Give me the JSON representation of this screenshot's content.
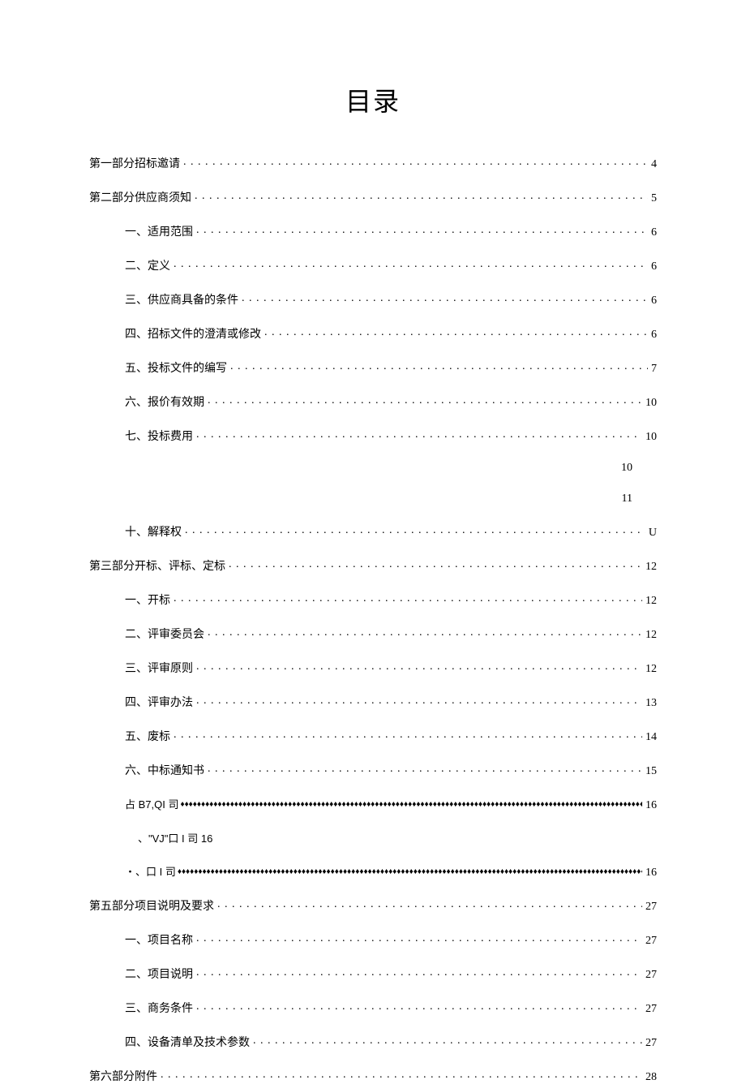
{
  "title": "目录",
  "entries": [
    {
      "level": 1,
      "label": "第一部分招标邀请",
      "page": "4",
      "leader": "dot"
    },
    {
      "level": 1,
      "label": "第二部分供应商须知",
      "page": "5",
      "leader": "dot"
    },
    {
      "level": 2,
      "label": "一、适用范围",
      "page": "6",
      "leader": "dot"
    },
    {
      "level": 2,
      "label": "二、定义",
      "page": "6",
      "leader": "dot"
    },
    {
      "level": 2,
      "label": "三、供应商具备的条件",
      "page": "6",
      "leader": "dot"
    },
    {
      "level": 2,
      "label": "四、招标文件的澄清或修改",
      "page": "6",
      "leader": "dot"
    },
    {
      "level": 2,
      "label": "五、投标文件的编写",
      "page": "7",
      "leader": "dot"
    },
    {
      "level": 2,
      "label": "六、报价有效期",
      "page": "10",
      "leader": "dot"
    },
    {
      "level": 2,
      "label": "七、投标费用",
      "page": "10",
      "leader": "dot"
    },
    {
      "level": "orphan",
      "page": "10"
    },
    {
      "level": "orphan",
      "page": "11"
    },
    {
      "level": 2,
      "label": "十、解释权",
      "page": "U",
      "leader": "dot"
    },
    {
      "level": 1,
      "label": "第三部分开标、评标、定标",
      "page": "12",
      "leader": "dot"
    },
    {
      "level": 2,
      "label": "一、开标",
      "page": "12",
      "leader": "dot"
    },
    {
      "level": 2,
      "label": "二、评审委员会",
      "page": "12",
      "leader": "dot"
    },
    {
      "level": 2,
      "label": "三、评审原则",
      "page": "12",
      "leader": "dot"
    },
    {
      "level": 2,
      "label": "四、评审办法",
      "page": "13",
      "leader": "dot"
    },
    {
      "level": 2,
      "label": "五、废标",
      "page": "14",
      "leader": "dot"
    },
    {
      "level": 2,
      "label": "六、中标通知书",
      "page": "15",
      "leader": "dot"
    },
    {
      "level": "special",
      "label": "占 B7,QI 司",
      "page": "16",
      "leader": "diamond"
    },
    {
      "level": "special2",
      "label": "、\"VJ\"口 I 司 16",
      "page": "",
      "leader": "none"
    },
    {
      "level": "special",
      "label": "・、口 I 司",
      "page": "16",
      "leader": "diamond"
    },
    {
      "level": 1,
      "label": "第五部分项目说明及要求",
      "page": "27",
      "leader": "dot"
    },
    {
      "level": 2,
      "label": "一、项目名称",
      "page": "27",
      "leader": "dot"
    },
    {
      "level": 2,
      "label": "二、项目说明",
      "page": "27",
      "leader": "dot"
    },
    {
      "level": 2,
      "label": "三、商务条件",
      "page": "27",
      "leader": "dot"
    },
    {
      "level": 2,
      "label": "四、设备清单及技术参数",
      "page": "27",
      "leader": "dot"
    },
    {
      "level": 1,
      "label": "第六部分附件",
      "page": "28",
      "leader": "dot"
    }
  ]
}
